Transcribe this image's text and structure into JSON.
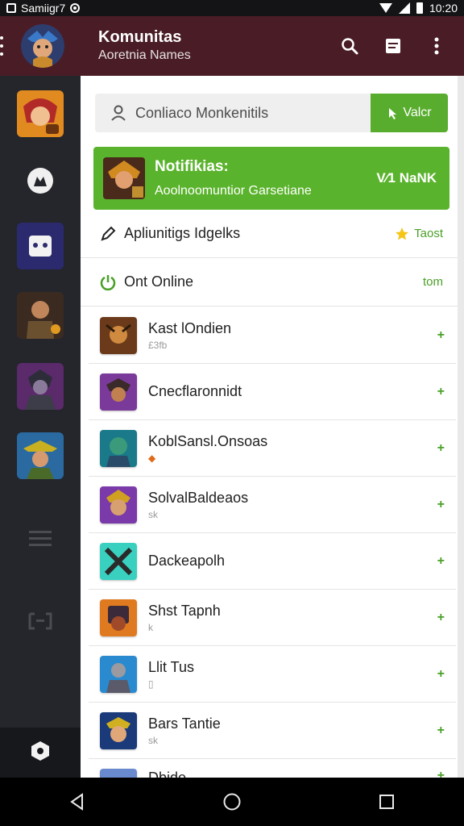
{
  "status_bar": {
    "carrier": "Samiigr7",
    "time": "10:20"
  },
  "header": {
    "title": "Komunitas",
    "subtitle": "Aoretnia Names"
  },
  "search": {
    "placeholder_text": "Conliaco Monkenitils",
    "button_label": "Valcr"
  },
  "banner": {
    "title": "Notifikias:",
    "subtitle": "Aoolnoomuntior Garsetiane",
    "right_text": "V⁄1 NaNK"
  },
  "links": [
    {
      "label": "Apliunitigs Idgelks",
      "right": "Taost"
    },
    {
      "label": "Ont Online",
      "right": "tom"
    }
  ],
  "list": [
    {
      "name": "Kast lOndien",
      "sub": "£3fb"
    },
    {
      "name": "Cnecflaronnidt",
      "sub": ""
    },
    {
      "name": "KoblSansl.Onsoas",
      "sub": "◆"
    },
    {
      "name": "SolvalBaldeaos",
      "sub": "sk"
    },
    {
      "name": "Dackeapolh",
      "sub": ""
    },
    {
      "name": "Shst Tapnh",
      "sub": "k"
    },
    {
      "name": "Llit Tus",
      "sub": "▯"
    },
    {
      "name": "Bars Tantie",
      "sub": "sk"
    },
    {
      "name": "Dbide",
      "sub": ""
    }
  ],
  "list_add_symbol": "+",
  "colors": {
    "app_bar": "#4a1d26",
    "accent_green": "#58ad2e",
    "rail": "#24262c"
  },
  "icons": {
    "header": [
      "search-icon",
      "document-icon",
      "more-vert-icon"
    ],
    "rail": [
      "game-avatar-1",
      "shield-icon",
      "robot-icon",
      "game-avatar-2",
      "game-avatar-3",
      "game-avatar-4",
      "menu-lines-icon",
      "chat-icon",
      "settings-hex-icon"
    ],
    "nav": [
      "back-icon",
      "home-icon",
      "recents-icon"
    ]
  }
}
